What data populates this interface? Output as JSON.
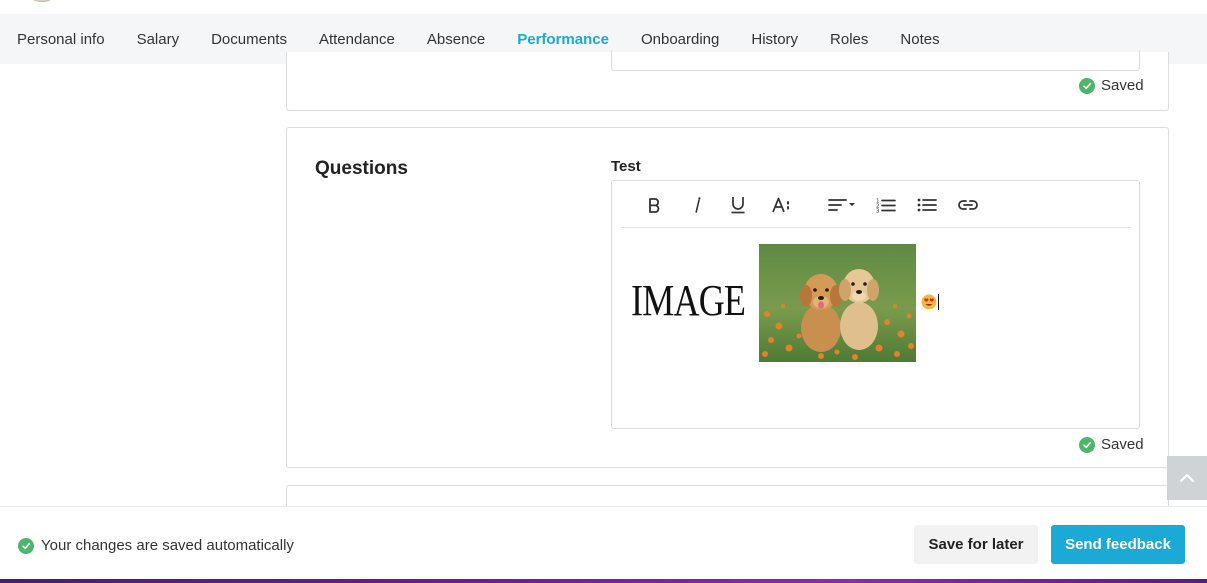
{
  "tabs": [
    {
      "label": "Personal info",
      "active": false
    },
    {
      "label": "Salary",
      "active": false
    },
    {
      "label": "Documents",
      "active": false
    },
    {
      "label": "Attendance",
      "active": false
    },
    {
      "label": "Absence",
      "active": false
    },
    {
      "label": "Performance",
      "active": true
    },
    {
      "label": "Onboarding",
      "active": false
    },
    {
      "label": "History",
      "active": false
    },
    {
      "label": "Roles",
      "active": false
    },
    {
      "label": "Notes",
      "active": false
    }
  ],
  "previous_card": {
    "status": "Saved"
  },
  "questions_card": {
    "title": "Questions",
    "field_label": "Test",
    "status": "Saved",
    "editor": {
      "toolbar": [
        "bold-icon",
        "italic-icon",
        "underline-icon",
        "font-size-icon",
        "align-icon",
        "ordered-list-icon",
        "bullet-list-icon",
        "link-icon"
      ],
      "content_text": "IMAGE",
      "content_image": "puppies-photo",
      "content_emoji": "heart-eyes-emoji"
    }
  },
  "footer": {
    "auto_save_message": "Your changes are saved automatically",
    "save_later_label": "Save for later",
    "send_feedback_label": "Send feedback"
  },
  "colors": {
    "accent": "#1ba9d6",
    "success": "#4cb76b"
  }
}
